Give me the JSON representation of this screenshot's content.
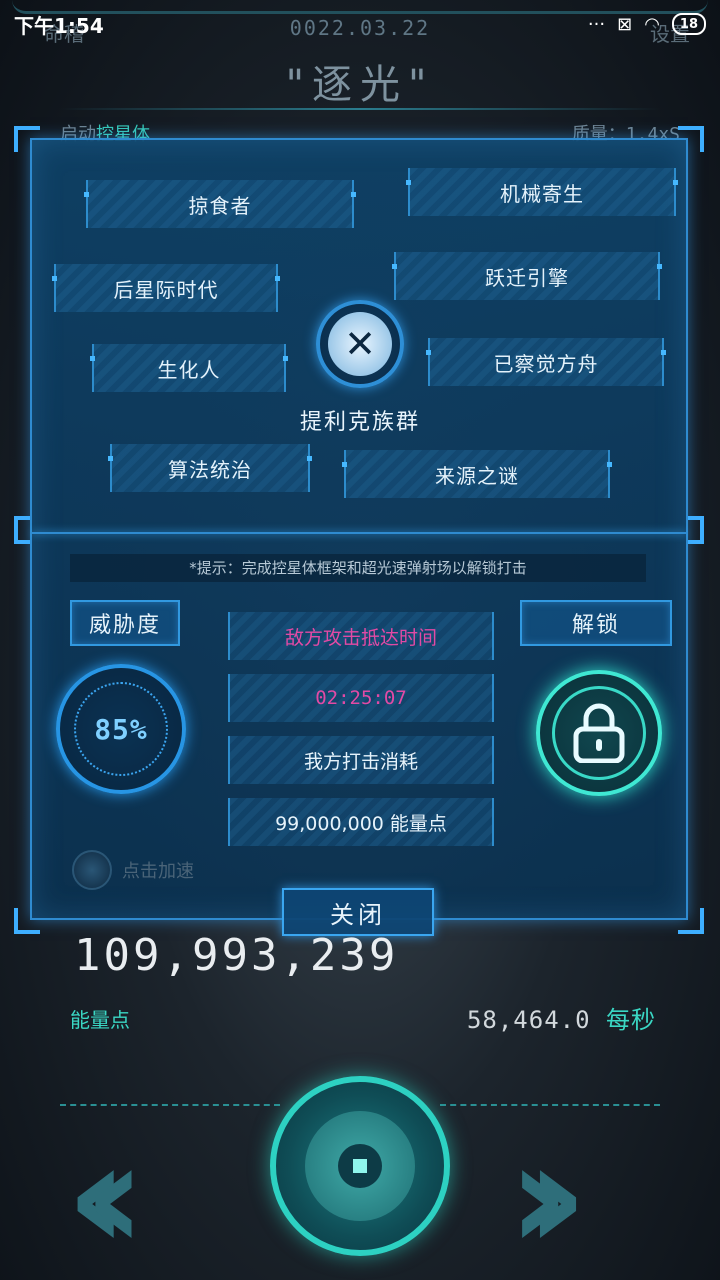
{
  "status_bar": {
    "time": "下午1:54",
    "battery": "18"
  },
  "background": {
    "date": "0022.03.22",
    "title": "\"逐光\"",
    "left_tab": "命稽",
    "right_tab": "设置",
    "line_prefix": "启动",
    "line_highlight": "控星体",
    "line_right": "质量：1.4xS"
  },
  "modal": {
    "traits": [
      "掠食者",
      "机械寄生",
      "后星际时代",
      "跃迁引擎",
      "生化人",
      "已察觉方舟",
      "算法统治",
      "来源之谜"
    ],
    "civilization_name": "提利克族群",
    "hint": "*提示：完成控星体框架和超光速弹射场以解锁打击",
    "threat_label": "威胁度",
    "threat_value": "85%",
    "unlock_label": "解锁",
    "attack_time_label": "敌方攻击抵达时间",
    "attack_time_value": "02:25:07",
    "strike_cost_label": "我方打击消耗",
    "strike_cost_value": "99,000,000 能量点",
    "speedup_label": "点击加速",
    "close_label": "关闭"
  },
  "energy": {
    "total": "109,993,239",
    "label": "能量点",
    "rate_value": "58,464.0",
    "rate_unit": "每秒"
  },
  "colors": {
    "accent_blue": "#2f8bd0",
    "accent_teal": "#3ad7c4",
    "alert_pink": "#e24aa5"
  }
}
